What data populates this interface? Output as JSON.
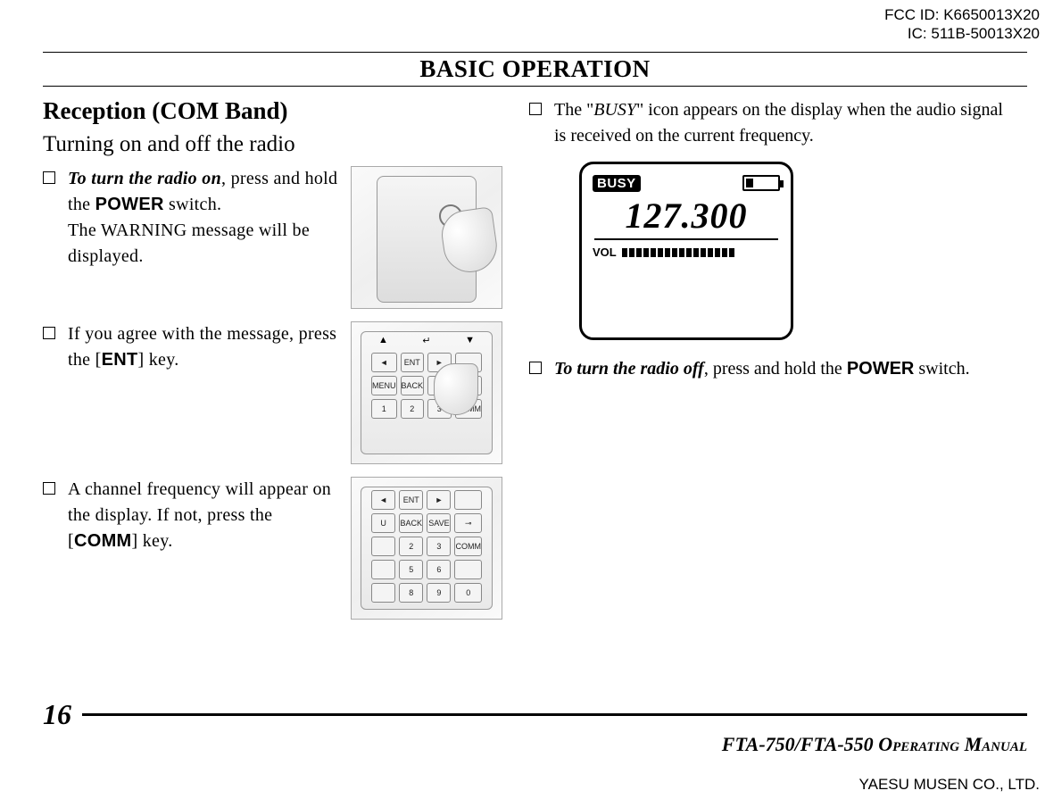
{
  "ids": {
    "fcc": "FCC ID: K6650013X20",
    "ic": "IC: 511B-50013X20"
  },
  "section_title": "BASIC OPERATION",
  "left": {
    "heading": "Reception (COM Band)",
    "subheading": "Turning on and off the radio",
    "items": [
      {
        "html": "<em><strong>To turn the radio on</strong></em>, press and hold the <span class=\"sans-bold\">POWER</span> switch.<br>The WARNING message will be displayed.",
        "fig": "radio-power"
      },
      {
        "html": "If you agree with the message, press the [<span class=\"sans-bold\">ENT</span>] key.",
        "fig": "keypad-ent"
      },
      {
        "html": "A channel frequency will appear on the display. If not, press the [<span class=\"sans-bold\">COMM</span>] key.",
        "fig": "keypad-comm"
      }
    ],
    "keypad_ent_keys": [
      "◄",
      "ENT",
      "►",
      "",
      "MENU",
      "BACK",
      "",
      "⊸",
      "1",
      "2",
      "3",
      "COMM"
    ],
    "keypad_comm_keys": [
      "◄",
      "ENT",
      "►",
      "",
      "U",
      "BACK",
      "SAVE",
      "⊸",
      "",
      "2",
      "3",
      "COMM",
      "",
      "5",
      "6",
      "",
      "",
      "8",
      "9",
      "0"
    ]
  },
  "right": {
    "items": [
      {
        "html": "The \"<em>BUSY</em>\" icon appears on the display when the audio signal is received on the current frequency."
      },
      {
        "html": "<em><strong>To turn the radio off</strong></em>, press and hold the <span class=\"sans-bold\">POWER</span> switch."
      }
    ],
    "lcd": {
      "busy": "BUSY",
      "frequency": "127.300",
      "vol_label": "VOL",
      "vol_segments": 16
    }
  },
  "footer": {
    "page_number": "16",
    "manual_title_main": "FTA-750/FTA-550 ",
    "manual_title_sc": "Operating Manual",
    "company": "YAESU MUSEN CO., LTD."
  }
}
